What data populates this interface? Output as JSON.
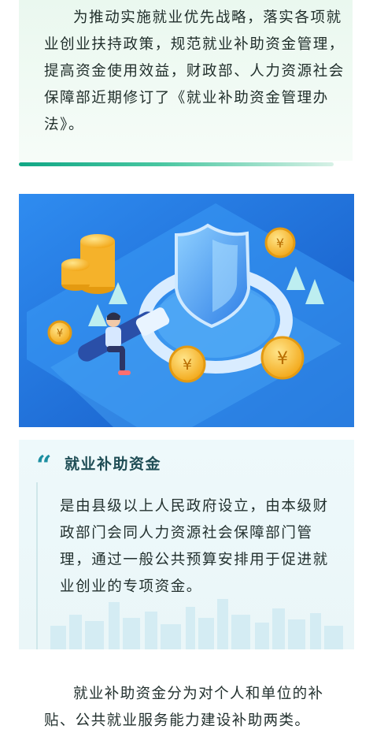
{
  "intro": {
    "text": "为推动实施就业优先战略，落实各项就业创业扶持政策，规范就业补助资金管理，提高资金使用效益，财政部、人力资源社会保障部近期修订了《就业补助资金管理办法》。"
  },
  "illustration": {
    "coin_symbol": "¥"
  },
  "definition": {
    "quote_mark": "“",
    "title": "就业补助资金",
    "text": "是由县级以上人民政府设立，由本级财政部门会同人力资源社会保障部门管理，通过一般公共预算安排用于促进就业创业的专项资金。"
  },
  "outro": {
    "text": "就业补助资金分为对个人和单位的补贴、公共就业服务能力建设补助两类。"
  },
  "colors": {
    "accent_green": "#11a785",
    "illustration_blue": "#1e73d9",
    "quote_teal": "#1c8ea1",
    "coin_gold": "#f7b928"
  }
}
